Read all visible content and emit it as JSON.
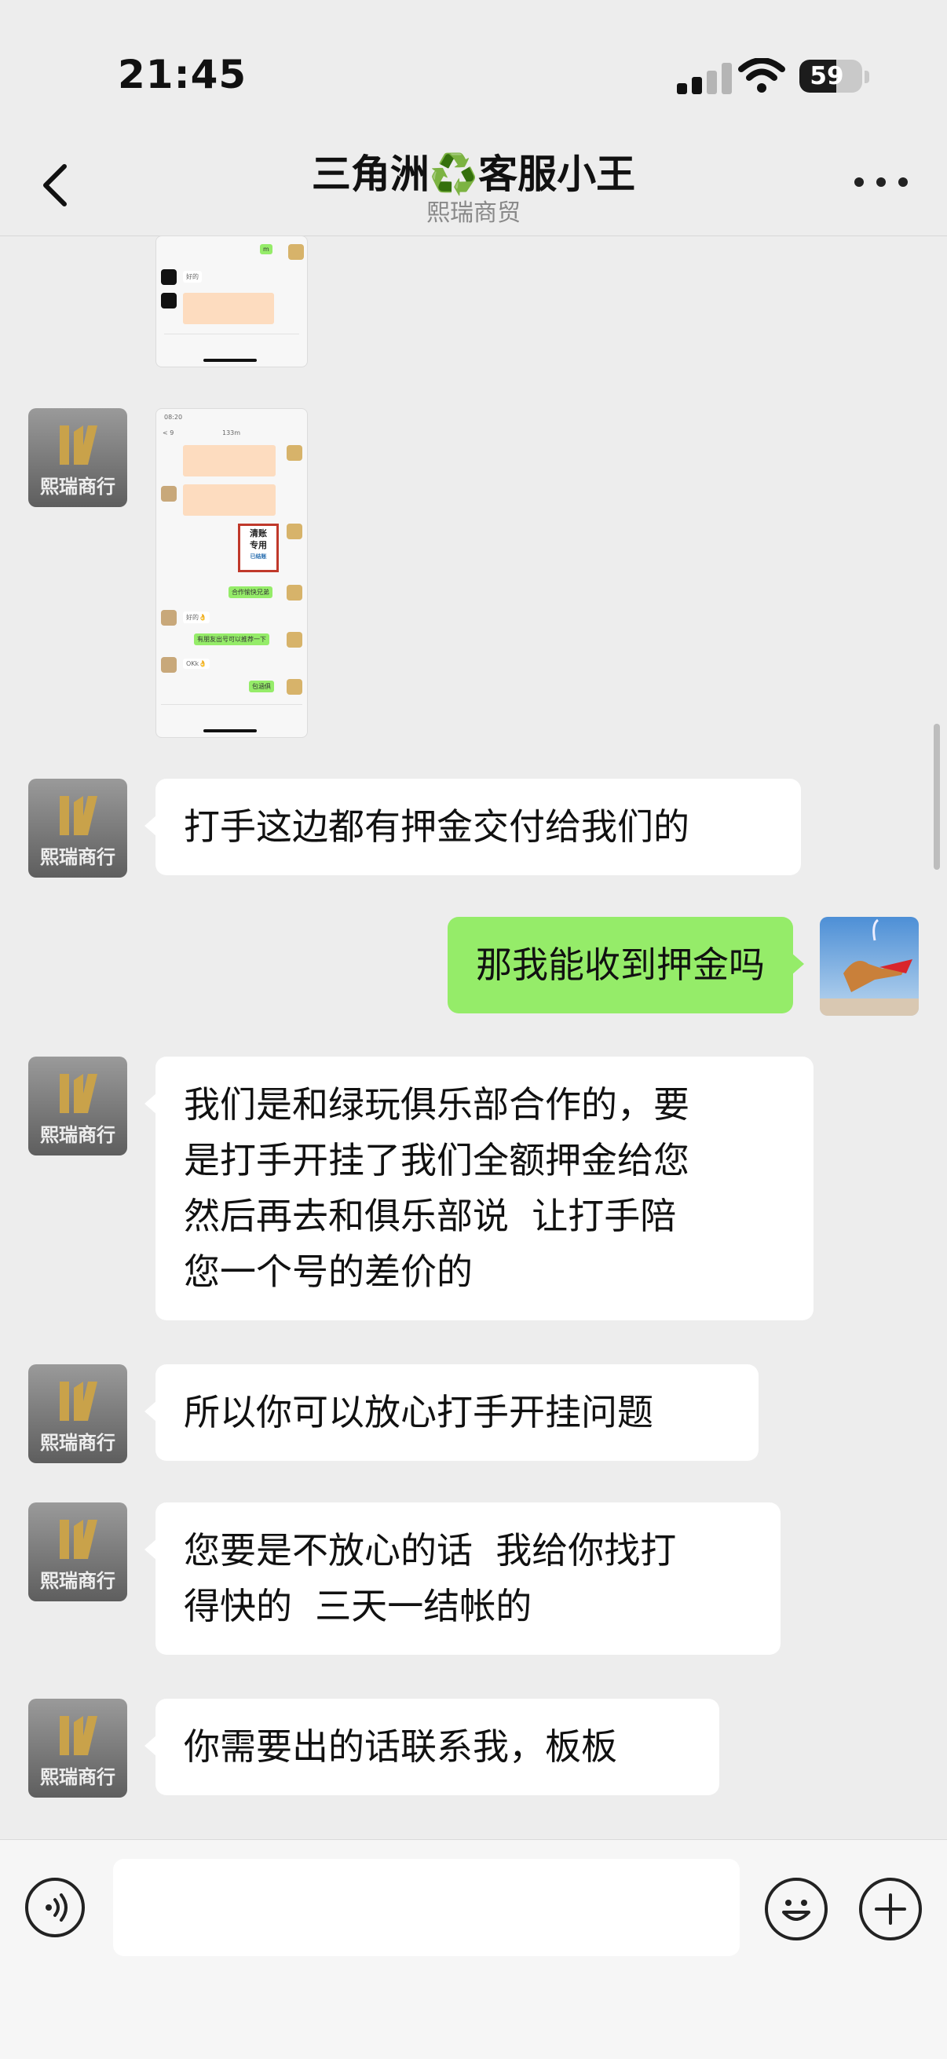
{
  "status_bar": {
    "time": "21:45",
    "battery": "59",
    "battery_level": 0.59
  },
  "header": {
    "title": "三角洲♻️客服小王",
    "subtitle": "熙瑞商贸"
  },
  "contact_avatar_text": "熙瑞商行",
  "screenshot1": {
    "msg_reply": "好的",
    "msg_green": "m"
  },
  "screenshot2": {
    "time": "08:20",
    "title": "133m",
    "back": "< 9",
    "stamp_line1": "清账",
    "stamp_line2": "专用",
    "stamp_line3": "已结账",
    "msg1": "合作愉快兄弟",
    "msg2": "好的👌",
    "msg3": "有朋友出号可以推荐一下",
    "msg4": "OKk👌",
    "msg5": "包涵俱"
  },
  "messages": [
    {
      "side": "left",
      "text": "打手这边都有押金交付给我们的"
    },
    {
      "side": "right",
      "text": "那我能收到押金吗"
    },
    {
      "side": "left",
      "text": "我们是和绿玩俱乐部合作的，要\n是打手开挂了我们全额押金给您\n然后再去和俱乐部说  让打手陪\n您一个号的差价的"
    },
    {
      "side": "left",
      "text": "所以你可以放心打手开挂问题"
    },
    {
      "side": "left",
      "text": "您要是不放心的话  我给你找打\n得快的  三天一结帐的"
    },
    {
      "side": "left",
      "text": "你需要出的话联系我，板板"
    }
  ],
  "input": {
    "placeholder": ""
  },
  "colors": {
    "self_bubble": "#95ec69",
    "other_bubble": "#ffffff",
    "background": "#ededed"
  },
  "icons": [
    "chevron-left-icon",
    "more-icon",
    "voice-icon",
    "emoji-icon",
    "plus-icon",
    "wifi-icon",
    "signal-icon",
    "battery-icon"
  ]
}
